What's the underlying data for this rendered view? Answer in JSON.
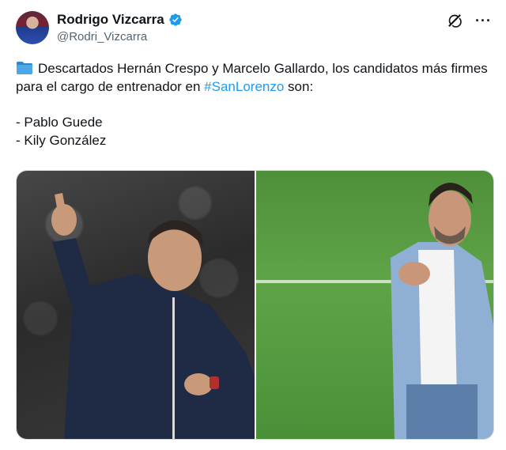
{
  "author": {
    "display_name": "Rodrigo Vizcarra",
    "handle": "@Rodri_Vizcarra",
    "verified": true
  },
  "header_icons": [
    "grok-icon",
    "more-icon"
  ],
  "more_label": "···",
  "tweet": {
    "line1": "Descartados Hernán Crespo y Marcelo Gallardo, los candidatos más firmes para el cargo de entrenador en ",
    "hashtag": "#SanLorenzo",
    "line1_end": " son:",
    "item1": "- Pablo Guede",
    "item2": "- Kily González"
  },
  "colors": {
    "link": "#1d9bf0",
    "text": "#0f1419",
    "secondary": "#536471",
    "verified": "#1d9bf0"
  },
  "media": [
    "coach-photo-left",
    "coach-photo-right"
  ]
}
